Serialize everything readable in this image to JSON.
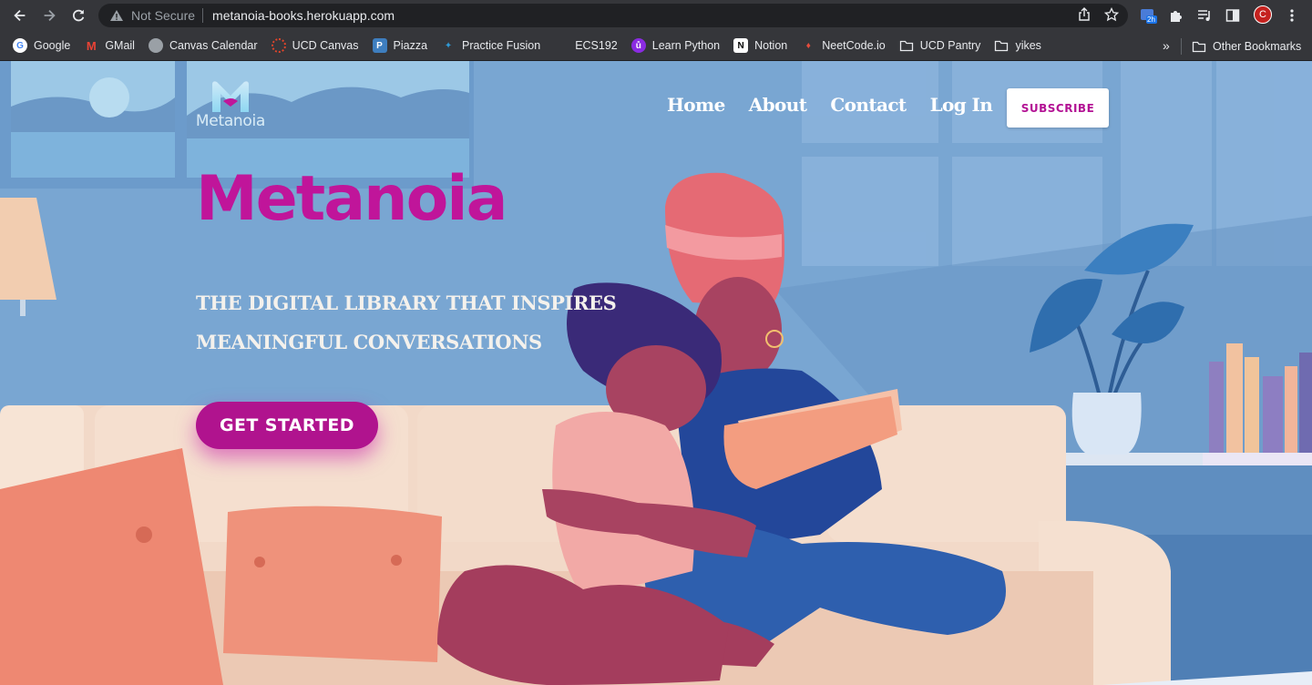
{
  "browser": {
    "security_status": "Not Secure",
    "url": "metanoia-books.herokuapp.com",
    "profile_initial": "C",
    "extension_badge": "2h",
    "bookmarks": [
      {
        "label": "Google",
        "icon": "google-icon"
      },
      {
        "label": "GMail",
        "icon": "gmail-icon"
      },
      {
        "label": "Canvas Calendar",
        "icon": "globe-icon"
      },
      {
        "label": "UCD Canvas",
        "icon": "canvas-icon"
      },
      {
        "label": "Piazza",
        "icon": "piazza-icon"
      },
      {
        "label": "Practice Fusion",
        "icon": "practice-fusion-icon"
      },
      {
        "label": "ECS192",
        "icon": "blank-icon"
      },
      {
        "label": "Learn Python",
        "icon": "python-icon"
      },
      {
        "label": "Notion",
        "icon": "notion-icon"
      },
      {
        "label": "NeetCode.io",
        "icon": "neetcode-icon"
      },
      {
        "label": "UCD Pantry",
        "icon": "folder-icon"
      },
      {
        "label": "yikes",
        "icon": "folder-icon"
      }
    ],
    "more_bookmarks": "»",
    "other_bookmarks": "Other Bookmarks"
  },
  "site": {
    "logo_text": "Metanoia",
    "nav": [
      "Home",
      "About",
      "Contact",
      "Log In"
    ],
    "subscribe_label": "SUBSCRIBE",
    "hero_title": "Metanoia",
    "tagline_line1": "THE DIGITAL LIBRARY THAT INSPIRES",
    "tagline_line2": "MEANINGFUL CONVERSATIONS",
    "cta_label": "GET STARTED"
  },
  "colors": {
    "brand_magenta": "#b0138e",
    "wall_blue": "#79a6d2",
    "sofa_cream": "#f2d9c8",
    "pillow_coral": "#ef8a73"
  }
}
